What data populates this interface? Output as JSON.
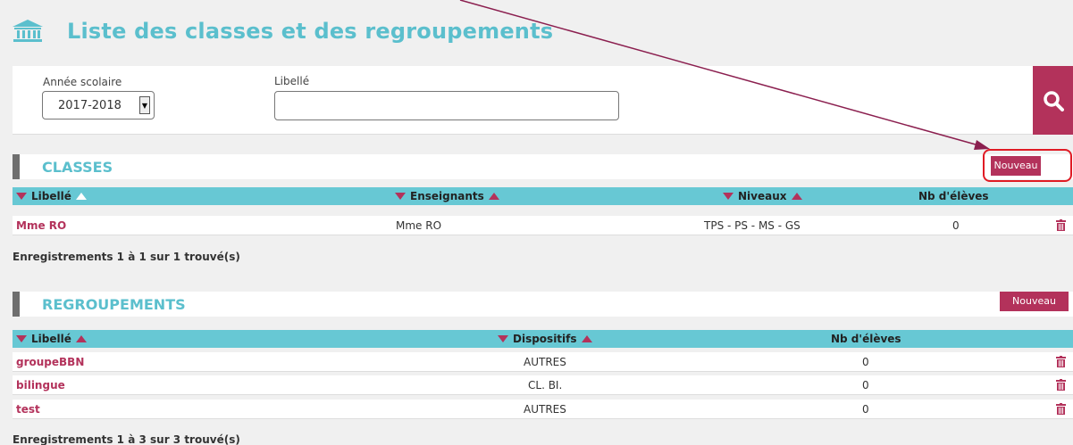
{
  "page": {
    "title": "Liste des classes et des regroupements"
  },
  "filters": {
    "year_label": "Année scolaire",
    "year_value": "2017-2018",
    "libelle_label": "Libellé",
    "libelle_value": ""
  },
  "classes": {
    "title": "CLASSES",
    "new_label": "Nouveau",
    "columns": [
      "Libellé",
      "Enseignants",
      "Niveaux",
      "Nb d'élèves"
    ],
    "rows": [
      {
        "libelle": "Mme RO",
        "enseignants": "Mme RO",
        "niveaux": "TPS - PS - MS - GS",
        "nb": "0"
      }
    ],
    "records": "Enregistrements 1 à 1 sur 1 trouvé(s)"
  },
  "regroupements": {
    "title": "REGROUPEMENTS",
    "new_label": "Nouveau",
    "columns": [
      "Libellé",
      "Dispositifs",
      "Nb d'élèves"
    ],
    "rows": [
      {
        "libelle": "groupeBBN",
        "dispositifs": "AUTRES",
        "nb": "0"
      },
      {
        "libelle": "bilingue",
        "dispositifs": "CL. BI.",
        "nb": "0"
      },
      {
        "libelle": "test",
        "dispositifs": "AUTRES",
        "nb": "0"
      }
    ],
    "records": "Enregistrements 1 à 3 sur 3 trouvé(s)"
  },
  "icons": {
    "header": "bank-icon",
    "search": "search-icon",
    "delete": "trash-icon",
    "sort_asc": "sort-up-icon",
    "sort_desc": "sort-down-icon"
  },
  "colors": {
    "accent": "#b3325b",
    "title": "#5bbfcd",
    "table_header": "#67c8d4",
    "annotation": "#8b1f4f",
    "highlight": "#e01b24"
  }
}
